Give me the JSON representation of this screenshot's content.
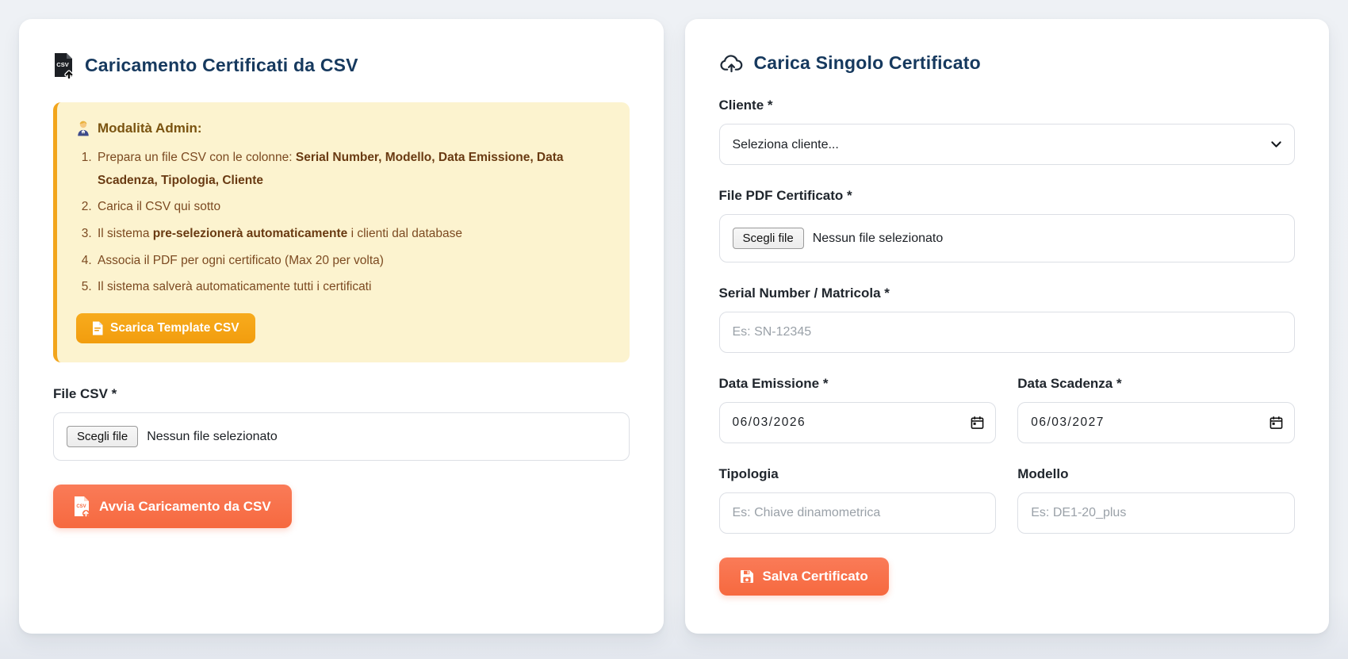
{
  "colors": {
    "accent_coral": "#f6693f",
    "accent_amber": "#f5a315",
    "title_navy": "#16395e",
    "warning_bg": "#fcf3cf",
    "warning_border": "#f2a51c",
    "warning_text": "#7c4a21"
  },
  "left_card": {
    "title": "Caricamento Certificati da CSV",
    "admin_box": {
      "heading": "Modalità Admin:",
      "items": [
        {
          "pre": "Prepara un file CSV con le colonne: ",
          "bold": "Serial Number, Modello, Data Emissione, Data Scadenza, Tipologia, Cliente",
          "post": ""
        },
        {
          "pre": "Carica il CSV qui sotto",
          "bold": "",
          "post": ""
        },
        {
          "pre": "Il sistema ",
          "bold": "pre-selezionerà automaticamente",
          "post": " i clienti dal database"
        },
        {
          "pre": "Associa il PDF per ogni certificato (Max 20 per volta)",
          "bold": "",
          "post": ""
        },
        {
          "pre": "Il sistema salverà automaticamente tutti i certificati",
          "bold": "",
          "post": ""
        }
      ],
      "template_button": "Scarica Template CSV"
    },
    "file_csv": {
      "label": "File CSV *",
      "button": "Scegli file",
      "status": "Nessun file selezionato"
    },
    "submit_button": "Avvia Caricamento da CSV"
  },
  "right_card": {
    "title": "Carica Singolo Certificato",
    "cliente": {
      "label": "Cliente *",
      "selected": "Seleziona cliente..."
    },
    "file_pdf": {
      "label": "File PDF Certificato *",
      "button": "Scegli file",
      "status": "Nessun file selezionato"
    },
    "serial": {
      "label": "Serial Number / Matricola *",
      "placeholder": "Es: SN-12345"
    },
    "data_emissione": {
      "label": "Data Emissione *",
      "value": "06/03/2026"
    },
    "data_scadenza": {
      "label": "Data Scadenza *",
      "value": "06/03/2027"
    },
    "tipologia": {
      "label": "Tipologia",
      "placeholder": "Es: Chiave dinamometrica"
    },
    "modello": {
      "label": "Modello",
      "placeholder": "Es: DE1-20_plus"
    },
    "submit_button": "Salva Certificato"
  }
}
